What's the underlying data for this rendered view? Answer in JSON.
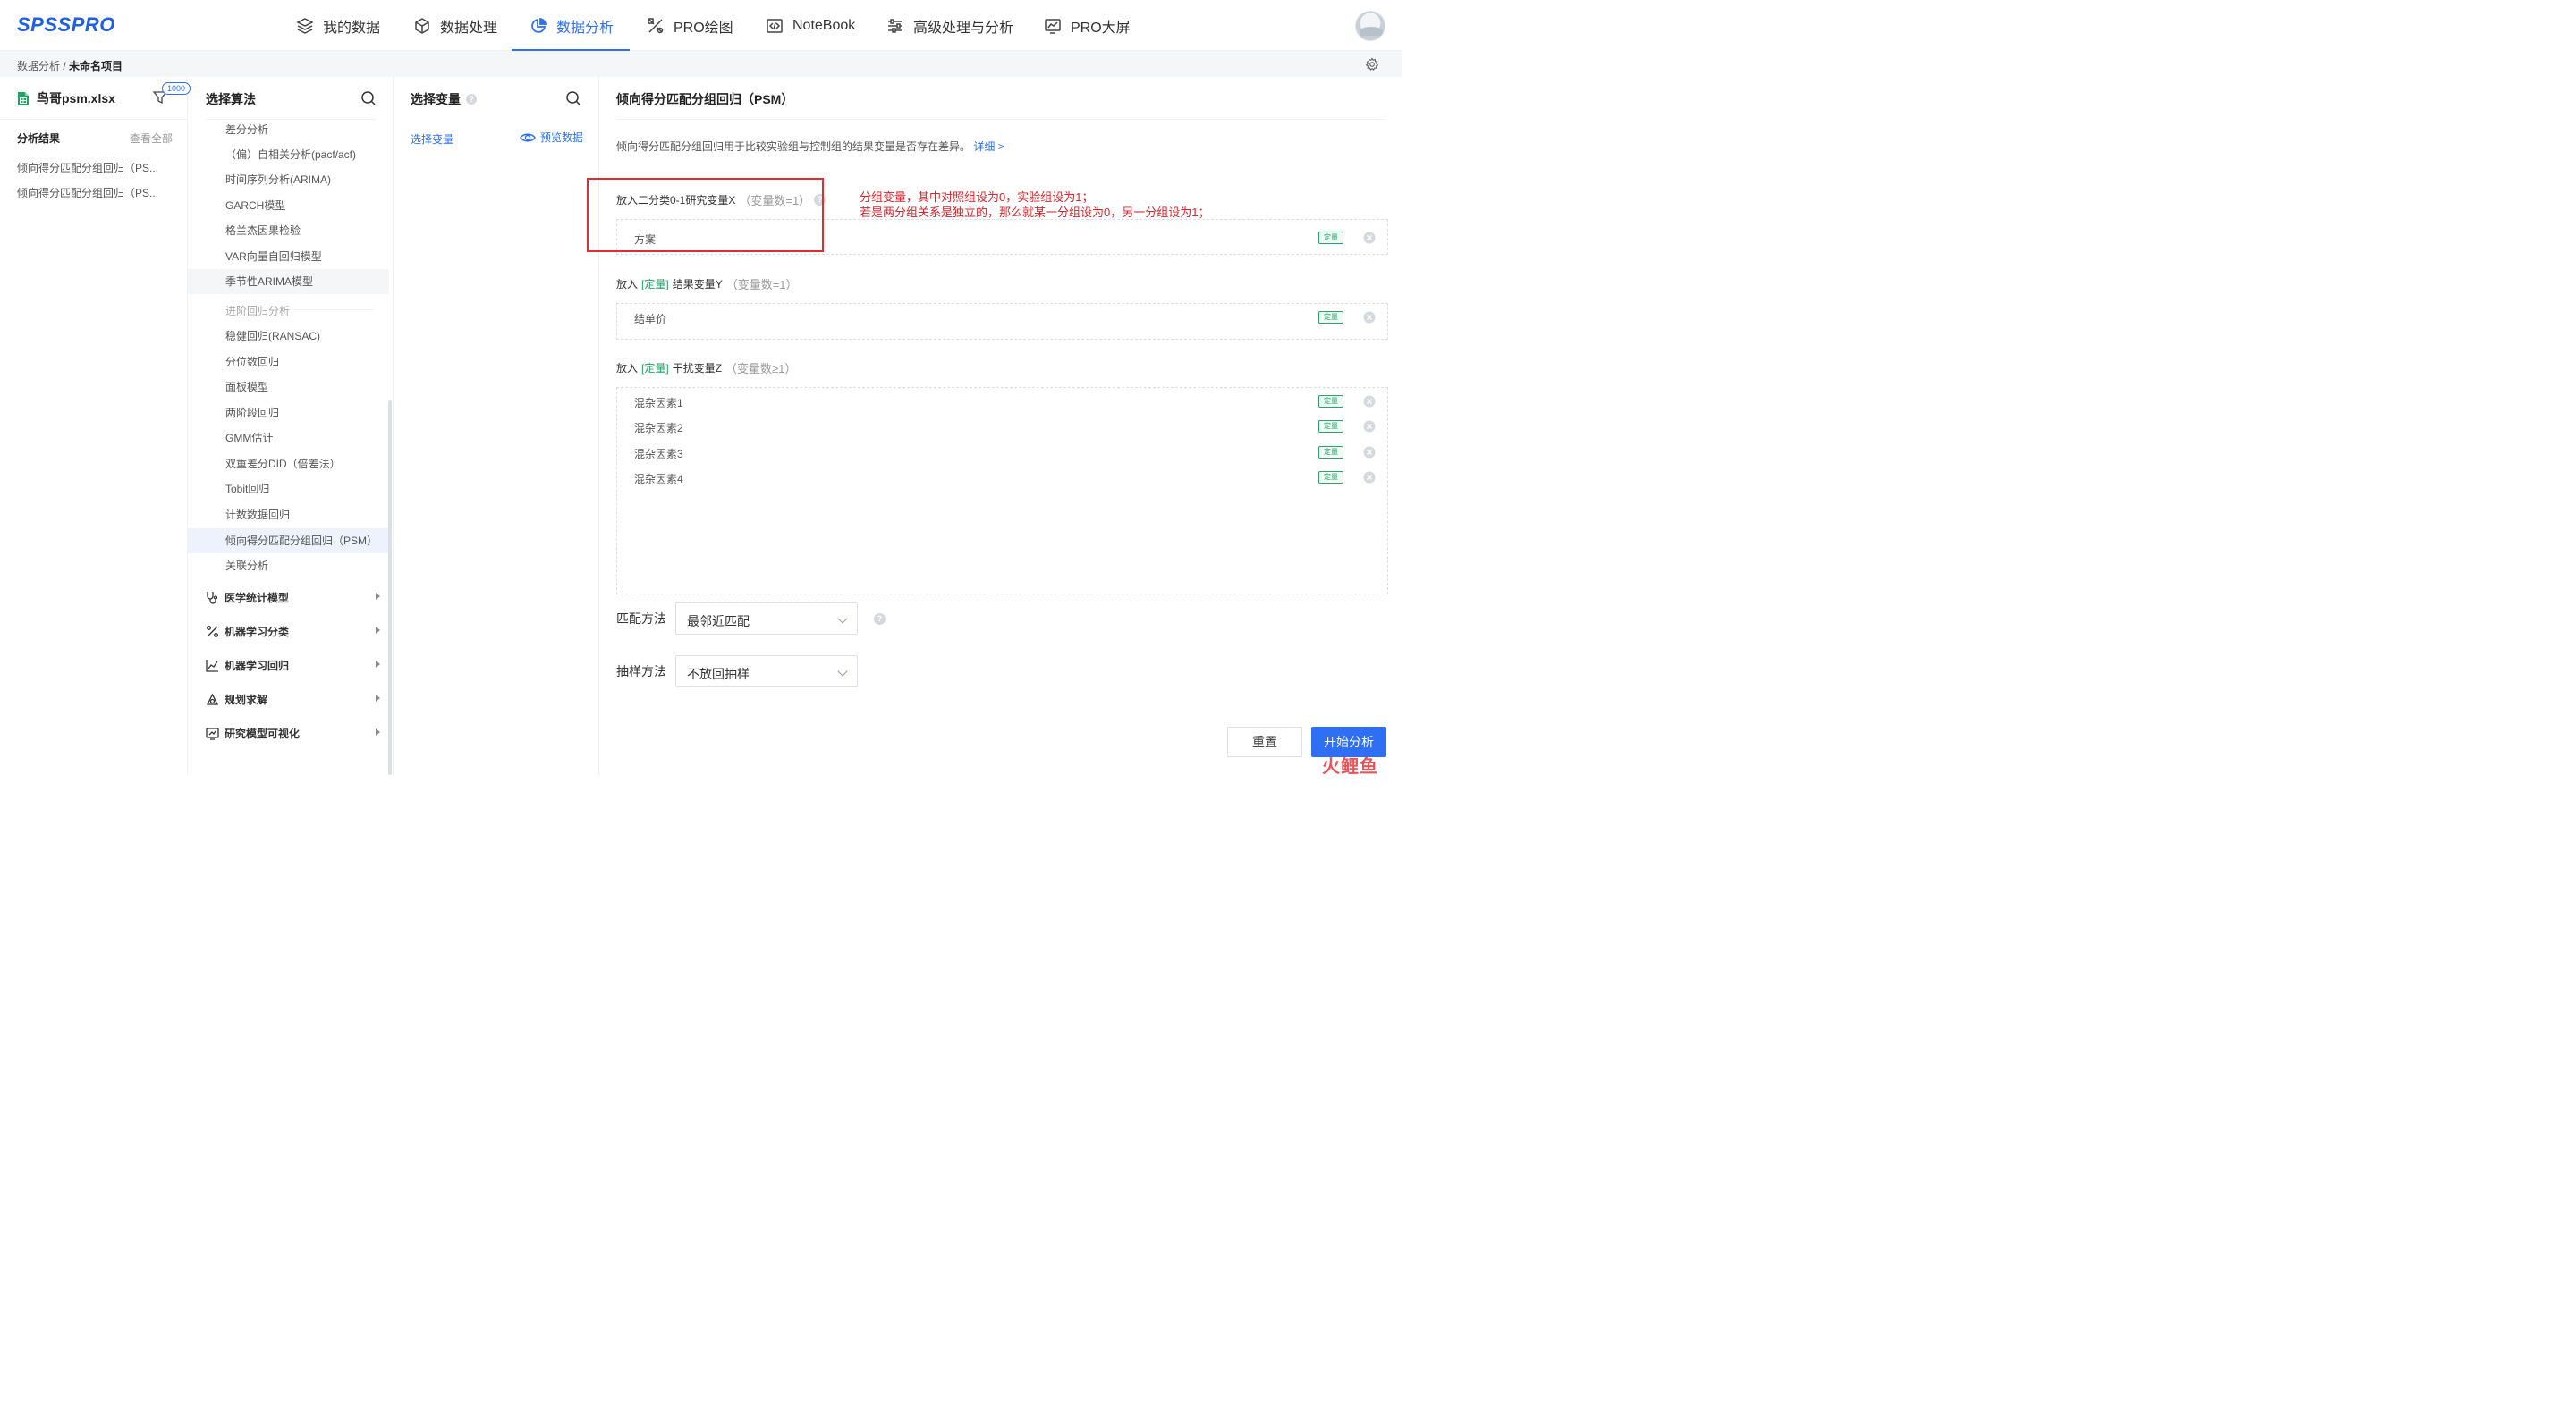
{
  "brand": {
    "logo": "SPSSPRO",
    "accent": "#2f6ff3",
    "annotation_color": "#d9242a"
  },
  "nav": {
    "items": [
      {
        "label": "我的数据",
        "icon": "layers-icon"
      },
      {
        "label": "数据处理",
        "icon": "cube-icon"
      },
      {
        "label": "数据分析",
        "icon": "pie-chart-icon",
        "active": true
      },
      {
        "label": "PRO绘图",
        "icon": "draw-tools-icon"
      },
      {
        "label": "NoteBook",
        "icon": "code-file-icon"
      },
      {
        "label": "高级处理与分析",
        "icon": "sliders-icon"
      },
      {
        "label": "PRO大屏",
        "icon": "dashboard-chart-icon"
      }
    ]
  },
  "breadcrumb": {
    "parent": "数据分析",
    "separator": " / ",
    "current": "未命名项目"
  },
  "left": {
    "file_name": "鸟哥psm.xlsx",
    "badge_count": "1000",
    "results_title": "分析结果",
    "view_all": "查看全部",
    "results": [
      "倾向得分匹配分组回归（PS...",
      "倾向得分匹配分组回归（PS..."
    ]
  },
  "algo": {
    "title": "选择算法",
    "items_top": [
      "差分分析",
      "（偏）自相关分析(pacf/acf)",
      "时间序列分析(ARIMA)",
      "GARCH模型",
      "格兰杰因果检验",
      "VAR向量自回归模型",
      "季节性ARIMA模型"
    ],
    "group_label": "进阶回归分析",
    "items_bottom": [
      "稳健回归(RANSAC)",
      "分位数回归",
      "面板模型",
      "两阶段回归",
      "GMM估计",
      "双重差分DID（倍差法）",
      "Tobit回归",
      "计数数据回归",
      "倾向得分匹配分组回归（PSM）",
      "关联分析"
    ],
    "categories": [
      "医学统计模型",
      "机器学习分类",
      "机器学习回归",
      "规划求解",
      "研究模型可视化"
    ]
  },
  "vars": {
    "title": "选择变量",
    "select_link": "选择变量",
    "preview_link": "预览数据"
  },
  "main": {
    "title": "倾向得分匹配分组回归（PSM）",
    "description": "倾向得分匹配分组回归用于比较实验组与控制组的结果变量是否存在差异。",
    "detail_link": "详细 >",
    "x_field": {
      "prefix": "放入二分类0-1研究变量X",
      "count": "（变量数=1）",
      "values": [
        "方案"
      ]
    },
    "y_field": {
      "prefix": "放入",
      "tag": "[定量]",
      "suffix": "结果变量Y",
      "count": "（变量数=1）",
      "values": [
        "结单价"
      ]
    },
    "z_field": {
      "prefix": "放入",
      "tag": "[定量]",
      "suffix": "干扰变量Z",
      "count": "（变量数≥1）",
      "values": [
        "混杂因素1",
        "混杂因素2",
        "混杂因素3",
        "混杂因素4"
      ]
    },
    "type_tag": "定量",
    "match_label": "匹配方法",
    "match_value": "最邻近匹配",
    "sample_label": "抽样方法",
    "sample_value": "不放回抽样",
    "reset_label": "重置",
    "start_label": "开始分析"
  },
  "annotation": {
    "line1": "分组变量，其中对照组设为0，实验组设为1；",
    "line2": "若是两分组关系是独立的，那么就某一分组设为0，另一分组设为1；"
  },
  "watermark": "火鲤鱼"
}
